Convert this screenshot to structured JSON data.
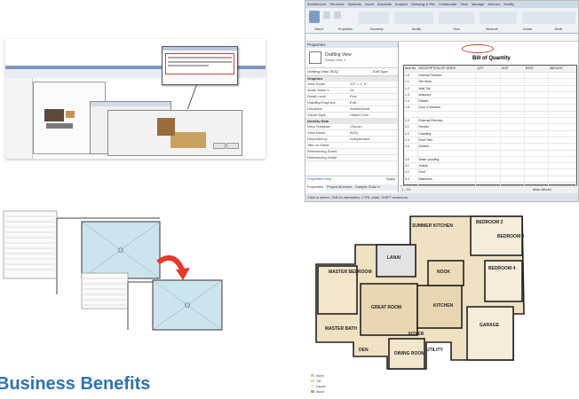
{
  "heading": "Business Benefits",
  "revit": {
    "tabs": [
      "Architecture",
      "Structure",
      "Systems",
      "Insert",
      "Annotate",
      "Analyze",
      "Massing & Site",
      "Collaborate",
      "View",
      "Manage",
      "Add-Ins",
      "Modify"
    ],
    "ribbon_groups": [
      "Select",
      "Properties",
      "Geometry",
      "Modify",
      "View",
      "Measure",
      "Create",
      "Mode"
    ],
    "properties_title": "Properties",
    "type_selector": "Drafting View",
    "type_sub": "Detail View 1",
    "view_dropdown": "Drafting View: BOQ",
    "edit_type": "Edit Type",
    "sections": [
      {
        "name": "Graphics",
        "rows": [
          [
            "View Scale",
            "1/2\" = 1'-0\""
          ],
          [
            "Scale Value 1:",
            "24"
          ],
          [
            "Detail Level",
            "Fine"
          ],
          [
            "Visibility/Graphics",
            "Edit..."
          ],
          [
            "Discipline",
            "Architectural"
          ],
          [
            "Visual Style",
            "Hidden Line"
          ]
        ]
      },
      {
        "name": "Identity Data",
        "rows": [
          [
            "View Template",
            "<None>"
          ],
          [
            "View Name",
            "BOQ"
          ],
          [
            "Dependency",
            "Independent"
          ],
          [
            "Title on Sheet",
            ""
          ],
          [
            "Referencing Sheet",
            ""
          ],
          [
            "Referencing Detail",
            ""
          ]
        ]
      }
    ],
    "properties_help": "Properties help",
    "apply": "Apply",
    "bottom_tabs": [
      "Properties",
      "Project Browser - Sample Solar H"
    ],
    "status": "Click to select, TAB for alternates, CTRL adds, SHIFT unselects.",
    "boq_title": "Bill of Quantity",
    "boq_columns": [
      "Item No.",
      "DESCRIPTION OF WORK",
      "QTY",
      "UNIT",
      "RATE",
      "AMOUNT"
    ],
    "boq_items": [
      [
        "1.0",
        "Internal Finishes"
      ],
      [
        "1.1",
        "Tile Work"
      ],
      [
        "1.2",
        "Wall Tile"
      ],
      [
        "1.3",
        "Masonry"
      ],
      [
        "1.4",
        "Plaster"
      ],
      [
        "1.5",
        "Door & Window"
      ],
      [
        "",
        ""
      ],
      [
        "2.0",
        "External Finishes"
      ],
      [
        "2.1",
        "Render"
      ],
      [
        "2.2",
        "Cladding"
      ],
      [
        "2.3",
        "Roof Tiles"
      ],
      [
        "2.4",
        "Gutters"
      ],
      [
        "",
        ""
      ],
      [
        "3.0",
        "Water proofing"
      ],
      [
        "3.1",
        "Toilets"
      ],
      [
        "3.2",
        "Roof"
      ],
      [
        "3.3",
        "Balconies"
      ],
      [
        "",
        ""
      ],
      [
        "4.0",
        "Mechanical Works"
      ],
      [
        "4.1",
        "Drains"
      ],
      [
        "4.2",
        "Ducts"
      ],
      [
        "4.3",
        "Plumbing"
      ],
      [
        "",
        ""
      ],
      [
        "5.0",
        "Elec. & Mech. Works"
      ]
    ],
    "zoom": "1 : 24",
    "filter": "Main Model"
  },
  "floorplan": {
    "rooms": [
      "MASTER BEDROOM",
      "LANAI",
      "BEDROOM 2",
      "BEDROOM 3",
      "BEDROOM 4",
      "GREAT ROOM",
      "KITCHEN",
      "NOOK",
      "GARAGE",
      "DINING ROOM",
      "FOYER",
      "DEN",
      "MASTER BATH",
      "UTILITY",
      "SUMMER KITCHEN"
    ],
    "legend": [
      "Stone",
      "Tile",
      "Carpet",
      "Wood"
    ]
  },
  "colors": {
    "heading": "#2e74b5",
    "arrow": "#e8382b",
    "viewport": "#cce4ee",
    "ribbon": "#d9e3ef"
  }
}
